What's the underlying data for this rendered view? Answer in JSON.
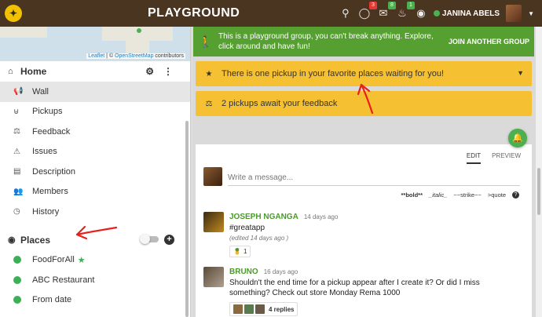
{
  "header": {
    "title": "PLAYGROUND",
    "badges": {
      "chat": "3",
      "messages": "8",
      "notifications": "1"
    },
    "badge_colors": {
      "chat": "#e53935",
      "messages": "#4caf50",
      "notifications": "#4caf50"
    },
    "user_name": "JANINA ABELS"
  },
  "map": {
    "attribution_leaflet": "Leaflet",
    "attribution_sep": " | © ",
    "attribution_osm": "OpenStreetMap",
    "attribution_tail": " contributors"
  },
  "sidebar": {
    "home_title": "Home",
    "home_items": [
      {
        "label": "Wall",
        "icon": "megaphone-icon"
      },
      {
        "label": "Pickups",
        "icon": "basket-icon"
      },
      {
        "label": "Feedback",
        "icon": "scale-icon"
      },
      {
        "label": "Issues",
        "icon": "warning-icon"
      },
      {
        "label": "Description",
        "icon": "id-card-icon"
      },
      {
        "label": "Members",
        "icon": "users-icon"
      },
      {
        "label": "History",
        "icon": "clock-icon"
      }
    ],
    "places_title": "Places",
    "places": [
      {
        "label": "FoodForAll",
        "favorite": true
      },
      {
        "label": "ABC Restaurant",
        "favorite": false
      },
      {
        "label": "From date",
        "favorite": false
      }
    ]
  },
  "banners": {
    "info_text": "This is a playground group, you can't break anything. Explore, click around and have fun!",
    "join_label": "JOIN ANOTHER GROUP",
    "pickup_waiting": "There is one pickup in your favorite places waiting for you!",
    "feedback_waiting": "2 pickups await your feedback"
  },
  "wall": {
    "tabs": [
      "EDIT",
      "PREVIEW"
    ],
    "placeholder": "Write a message...",
    "markdown_hint": [
      "**bold**",
      "_italic_",
      "~~strike~~",
      ">quote"
    ],
    "posts": [
      {
        "author": "JOSEPH NGANGA",
        "time": "14 days ago",
        "text": "#greatapp",
        "edited": "(edited 14 days ago )",
        "reaction_count": "1"
      },
      {
        "author": "BRUNO",
        "time": "16 days ago",
        "text": "Shouldn't the end time for a pickup appear after I create it? Or did I miss something? Check out store Monday Rema 1000",
        "replies": "4 replies"
      }
    ]
  },
  "colors": {
    "topbar": "#4a3520",
    "green_banner": "#55a030",
    "yellow_banner": "#f5c032",
    "accent_green": "#4caf50",
    "annotation_red": "#e8201c"
  }
}
